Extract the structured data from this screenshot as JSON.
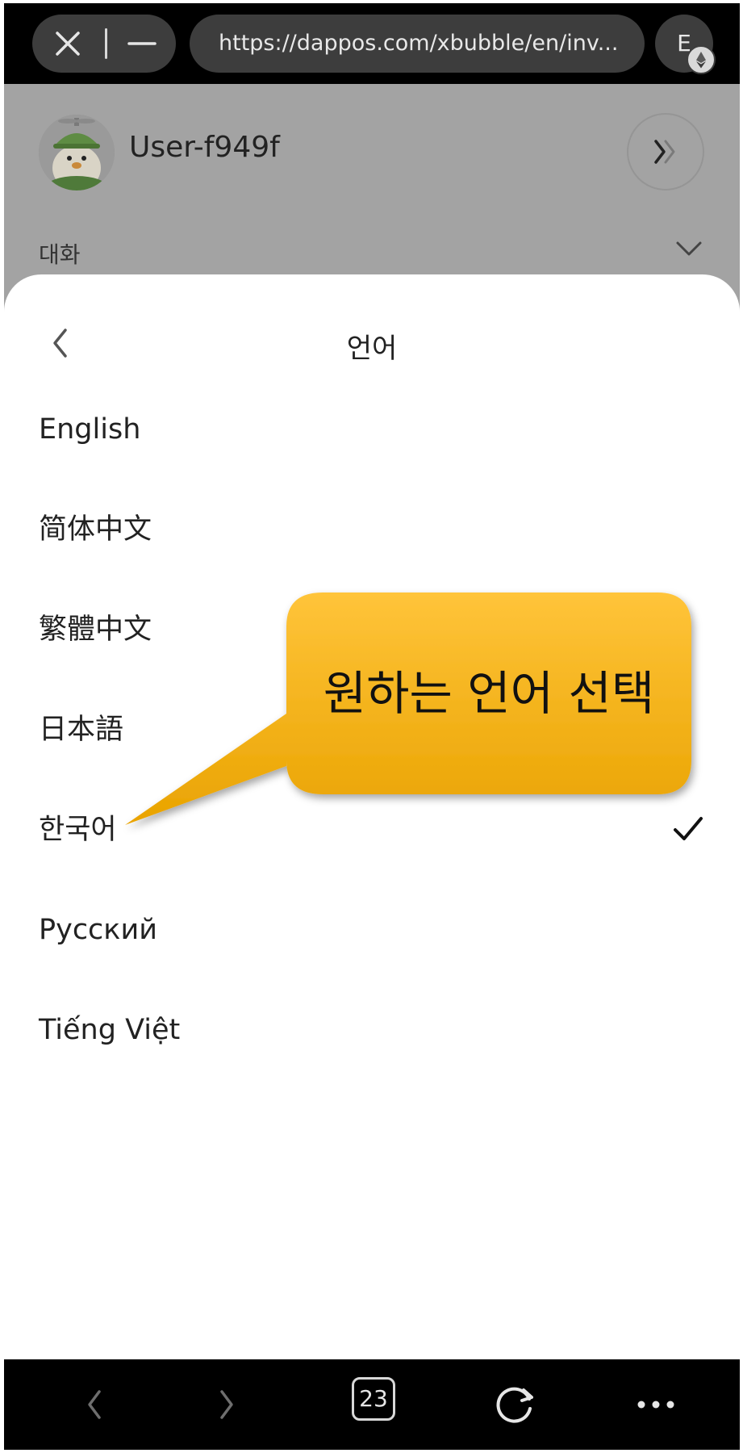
{
  "browser": {
    "url": "https://dappos.com/xbubble/en/inv...",
    "account_initial": "E",
    "tab_count": "23"
  },
  "profile": {
    "username": "User-f949f",
    "conversation_label": "대화"
  },
  "language_sheet": {
    "title": "언어",
    "items": [
      {
        "label": "English"
      },
      {
        "label": "简体中文"
      },
      {
        "label": "繁體中文"
      },
      {
        "label": "日本語"
      },
      {
        "label": "한국어",
        "selected": true
      },
      {
        "label": "Русский"
      },
      {
        "label": "Tiếng Việt"
      }
    ]
  },
  "annotation": {
    "text": "원하는 언어 선택",
    "fill_top": "#ffc43a",
    "fill_bottom": "#e9a300"
  },
  "colors": {
    "topbar": "#000000",
    "pill": "#3d3d3d",
    "dim_overlay": "#a3a3a3",
    "sheet": "#ffffff"
  },
  "icons": {
    "close": "close-icon",
    "minimize": "minimize-icon",
    "eth": "ethereum-icon",
    "next": "double-chevron-right-icon",
    "back": "chevron-left-icon",
    "check": "check-icon"
  }
}
